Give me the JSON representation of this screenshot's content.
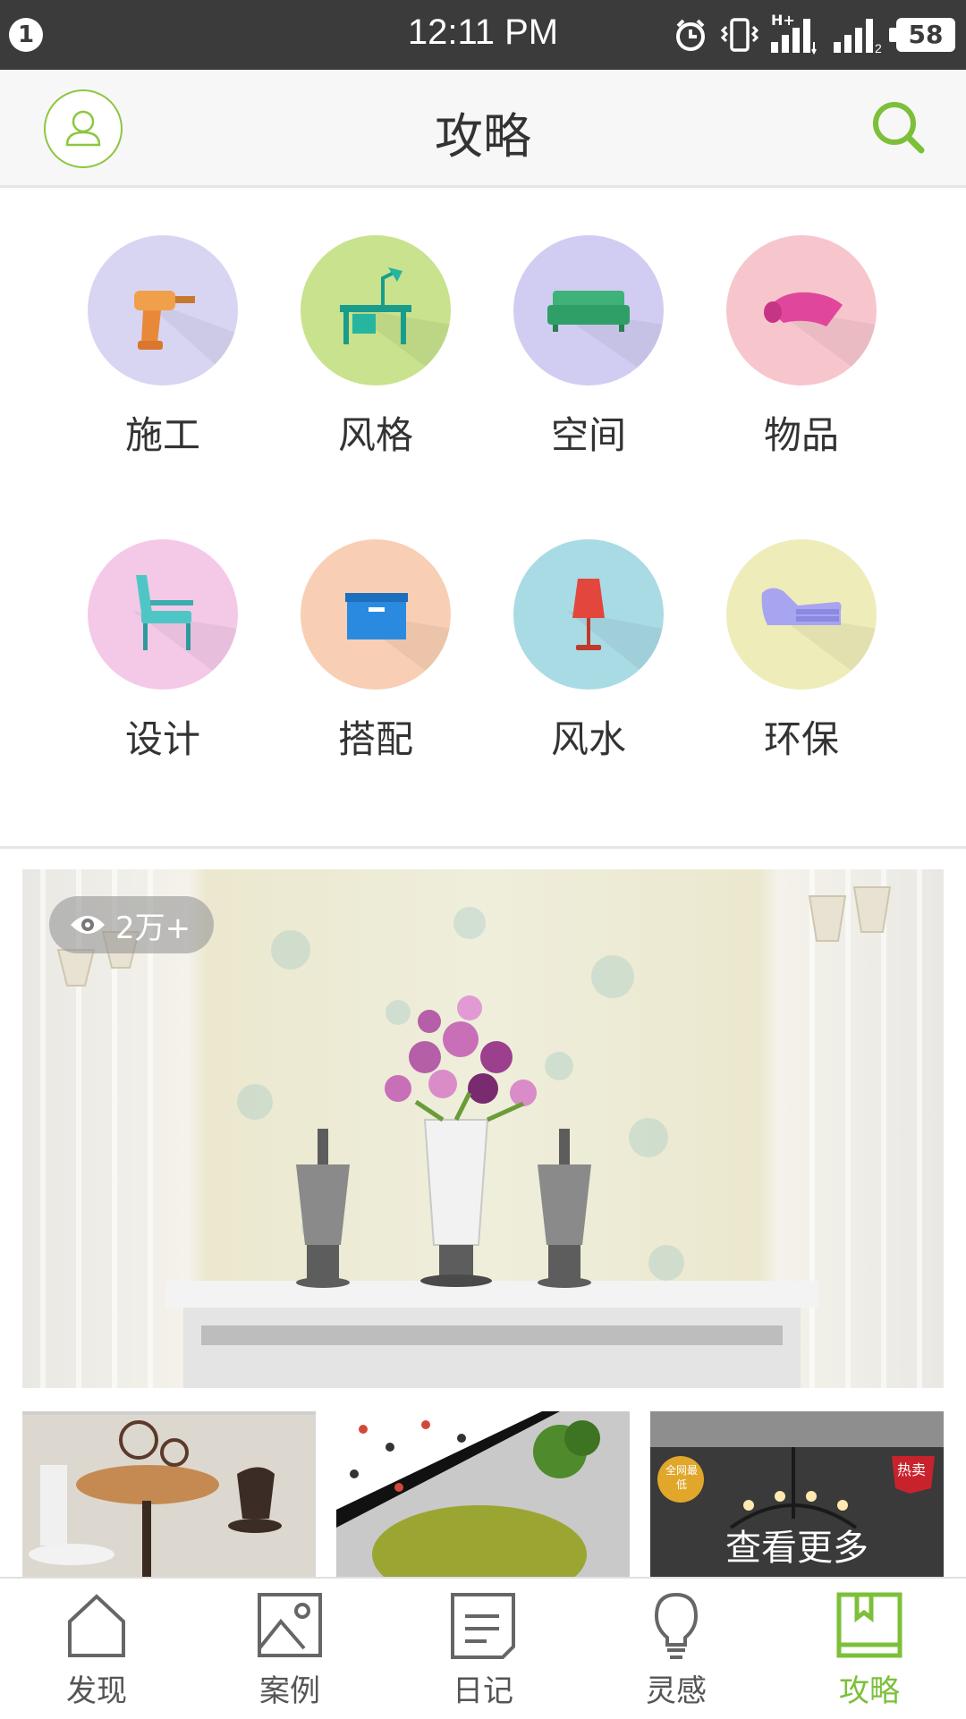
{
  "status_bar": {
    "notification_count": "1",
    "time": "12:11 PM",
    "network_label": "H+",
    "battery": "58"
  },
  "header": {
    "title": "攻略"
  },
  "categories": [
    {
      "label": "施工",
      "icon": "drill-icon",
      "color": "#d8d5f3"
    },
    {
      "label": "风格",
      "icon": "desk-lamp-icon",
      "color": "#c8e28e"
    },
    {
      "label": "空间",
      "icon": "sofa-icon",
      "color": "#d1cdf2"
    },
    {
      "label": "物品",
      "icon": "rug-roll-icon",
      "color": "#f7c6cd"
    },
    {
      "label": "设计",
      "icon": "chair-icon",
      "color": "#f4c9e8"
    },
    {
      "label": "搭配",
      "icon": "storage-box-icon",
      "color": "#f8cfb4"
    },
    {
      "label": "风水",
      "icon": "lamp-icon",
      "color": "#a9dbe5"
    },
    {
      "label": "环保",
      "icon": "chaise-icon",
      "color": "#eeecb8"
    }
  ],
  "banner": {
    "views": "2万+"
  },
  "thumbnails": {
    "see_more": "查看更多",
    "badge_left": "全网最低",
    "badge_right": "热卖"
  },
  "tabs": [
    {
      "label": "发现",
      "icon": "home-icon"
    },
    {
      "label": "案例",
      "icon": "image-icon"
    },
    {
      "label": "日记",
      "icon": "note-icon"
    },
    {
      "label": "灵感",
      "icon": "bulb-icon"
    },
    {
      "label": "攻略",
      "icon": "bookmark-icon",
      "active": true
    }
  ],
  "colors": {
    "accent": "#7cc03a",
    "status_bar": "#3b3b3b"
  }
}
